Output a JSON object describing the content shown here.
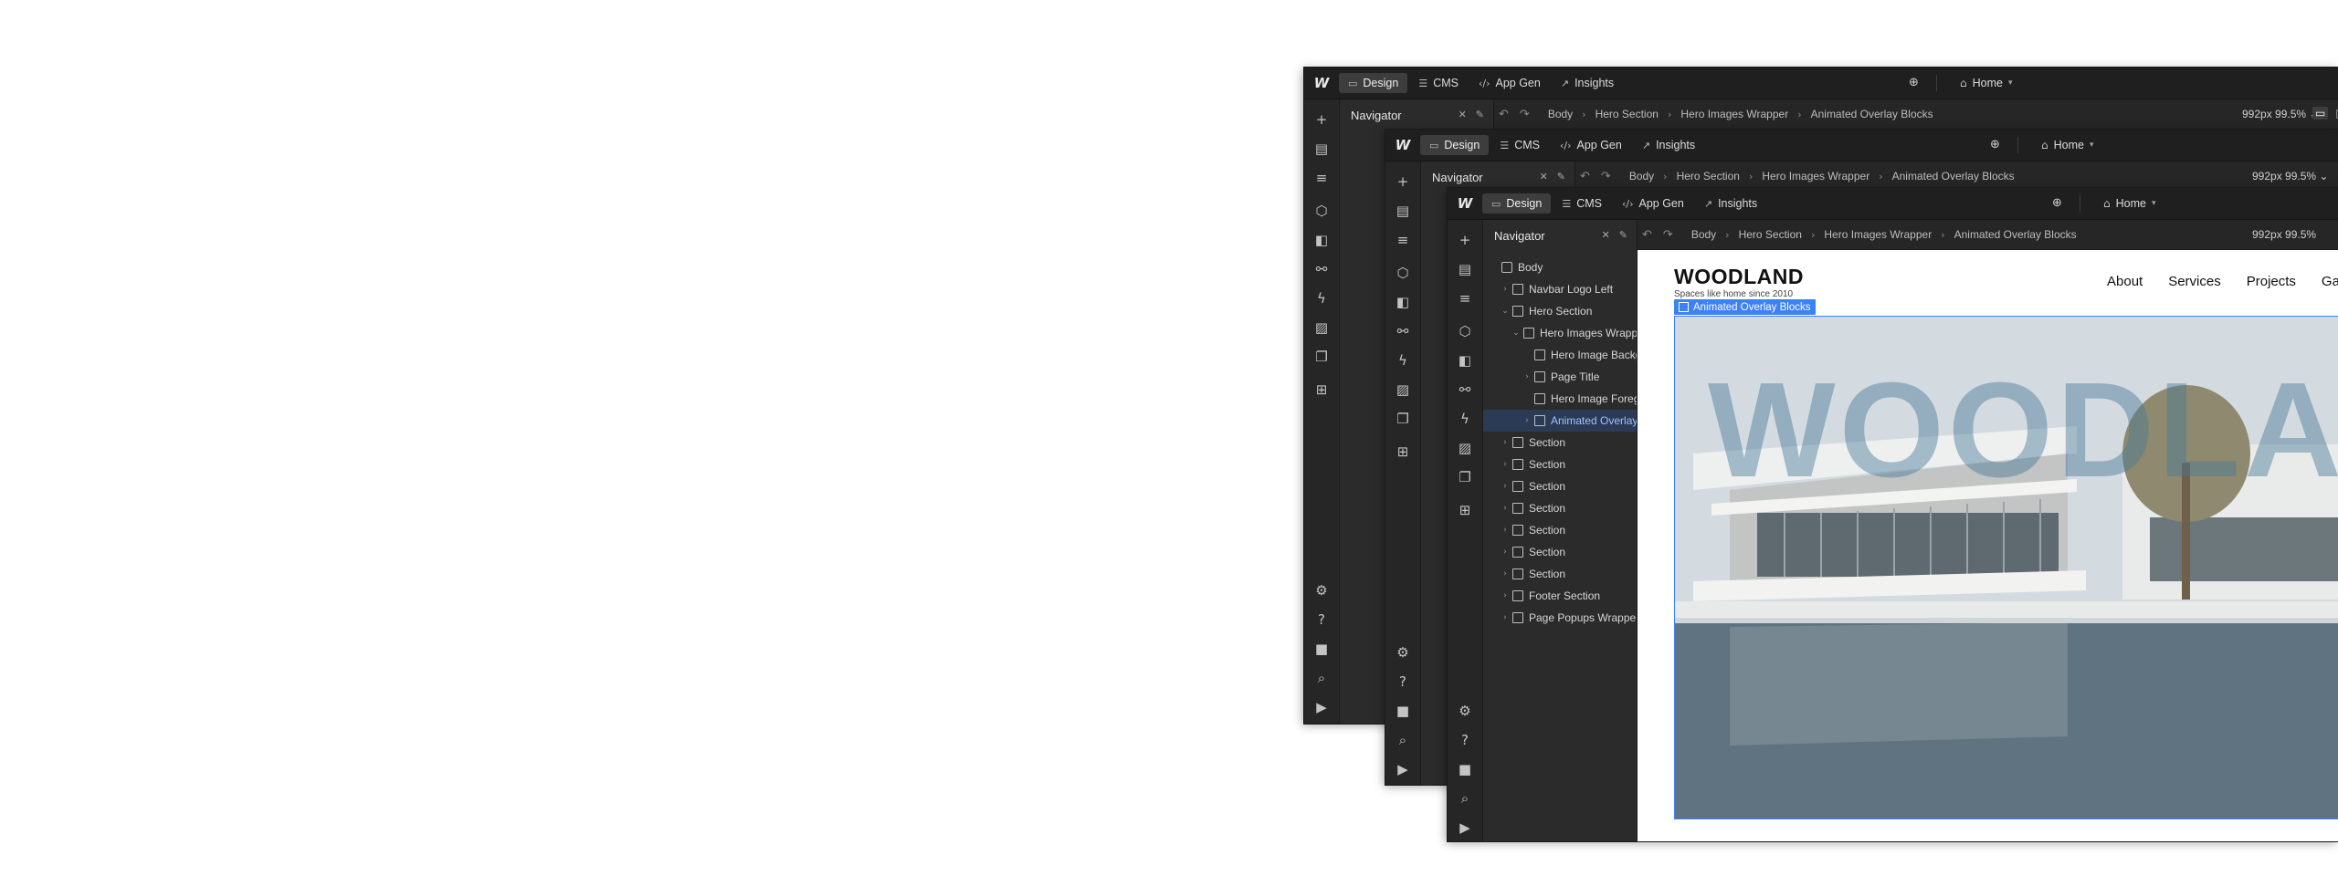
{
  "app": {
    "tabs": [
      {
        "label": "Design",
        "icon": "design-icon",
        "active": true
      },
      {
        "label": "CMS",
        "icon": "database-icon",
        "active": false
      },
      {
        "label": "App Gen",
        "icon": "code-icon",
        "active": false
      },
      {
        "label": "Insights",
        "icon": "chart-icon",
        "active": false
      }
    ],
    "page_selector": "Home",
    "zoom": "992px 99.5%"
  },
  "breadcrumb": [
    "Body",
    "Hero Section",
    "Hero Images Wrapper",
    "Animated Overlay Blocks"
  ],
  "navigator": {
    "title": "Navigator",
    "items": [
      {
        "label": "Body",
        "depth": 0,
        "twisty": "",
        "box": true
      },
      {
        "label": "Navbar Logo Left",
        "depth": 1,
        "twisty": "›",
        "box": true
      },
      {
        "label": "Hero Section",
        "depth": 1,
        "twisty": "⌄",
        "box": true
      },
      {
        "label": "Hero Images Wrapper",
        "depth": 2,
        "twisty": "⌄",
        "box": true
      },
      {
        "label": "Hero Image Background",
        "depth": 3,
        "twisty": "",
        "box": true
      },
      {
        "label": "Page Title",
        "depth": 3,
        "twisty": "›",
        "box": true
      },
      {
        "label": "Hero Image Foreground",
        "depth": 3,
        "twisty": "",
        "box": true
      },
      {
        "label": "Animated Overlay Blocks",
        "depth": 3,
        "twisty": "›",
        "box": true,
        "selected": true
      },
      {
        "label": "Section",
        "depth": 1,
        "twisty": "›",
        "box": true
      },
      {
        "label": "Section",
        "depth": 1,
        "twisty": "›",
        "box": true
      },
      {
        "label": "Section",
        "depth": 1,
        "twisty": "›",
        "box": true
      },
      {
        "label": "Section",
        "depth": 1,
        "twisty": "›",
        "box": true
      },
      {
        "label": "Section",
        "depth": 1,
        "twisty": "›",
        "box": true
      },
      {
        "label": "Section",
        "depth": 1,
        "twisty": "›",
        "box": true
      },
      {
        "label": "Section",
        "depth": 1,
        "twisty": "›",
        "box": true
      },
      {
        "label": "Footer Section",
        "depth": 1,
        "twisty": "›",
        "box": true
      },
      {
        "label": "Page Popups Wrapper",
        "depth": 1,
        "twisty": "›",
        "box": true
      }
    ]
  },
  "site": {
    "logo": "WOODLAND",
    "tagline": "Spaces like home since 2010",
    "nav": [
      "About",
      "Services",
      "Projects",
      "Gallery"
    ],
    "selected_element": "Animated Overlay Blocks",
    "hero_word": "WOODLAND"
  }
}
